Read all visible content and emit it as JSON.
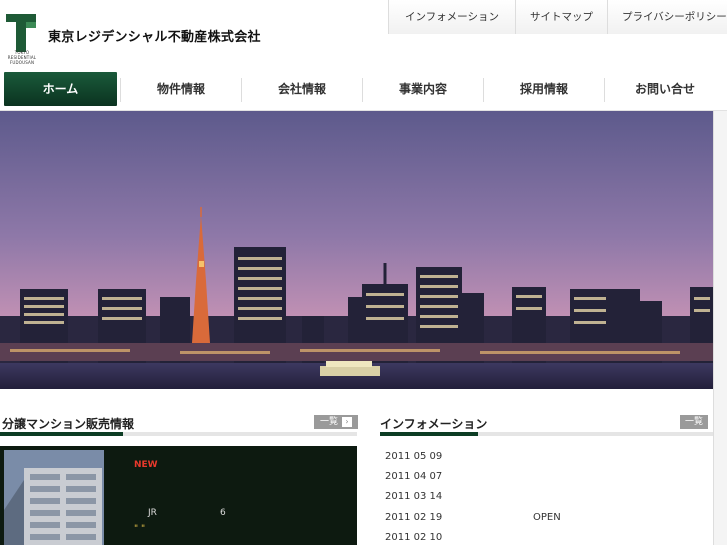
{
  "header": {
    "company_name": "東京レジデンシャル不動産株式会社",
    "logo_small_text": "TOKYO RESIDENTIAL FUDOUSAN",
    "util_nav": [
      "インフォメーション",
      "サイトマップ",
      "プライバシーポリシー"
    ]
  },
  "global_nav": [
    "ホーム",
    "物件情報",
    "会社情報",
    "事業内容",
    "採用情報",
    "お問い合せ"
  ],
  "sale_section": {
    "title": "分譲マンション販売情報",
    "more_label": "一覧",
    "new_badge": "NEW",
    "line1_a": "JR",
    "line1_b": "6",
    "line2": "\"  \""
  },
  "info_section": {
    "title": "インフォメーション",
    "more_label": "一覧",
    "items": [
      {
        "date": "2011 05 09",
        "text": ""
      },
      {
        "date": "2011 04 07",
        "text": ""
      },
      {
        "date": "2011 03 14",
        "text": ""
      },
      {
        "date": "2011 02 19",
        "text": "OPEN"
      },
      {
        "date": "2011 02 10",
        "text": ""
      }
    ]
  },
  "colors": {
    "brand_green": "#0d3d24",
    "nav_active": "#1a5a3a",
    "new_red": "#e8392c"
  }
}
